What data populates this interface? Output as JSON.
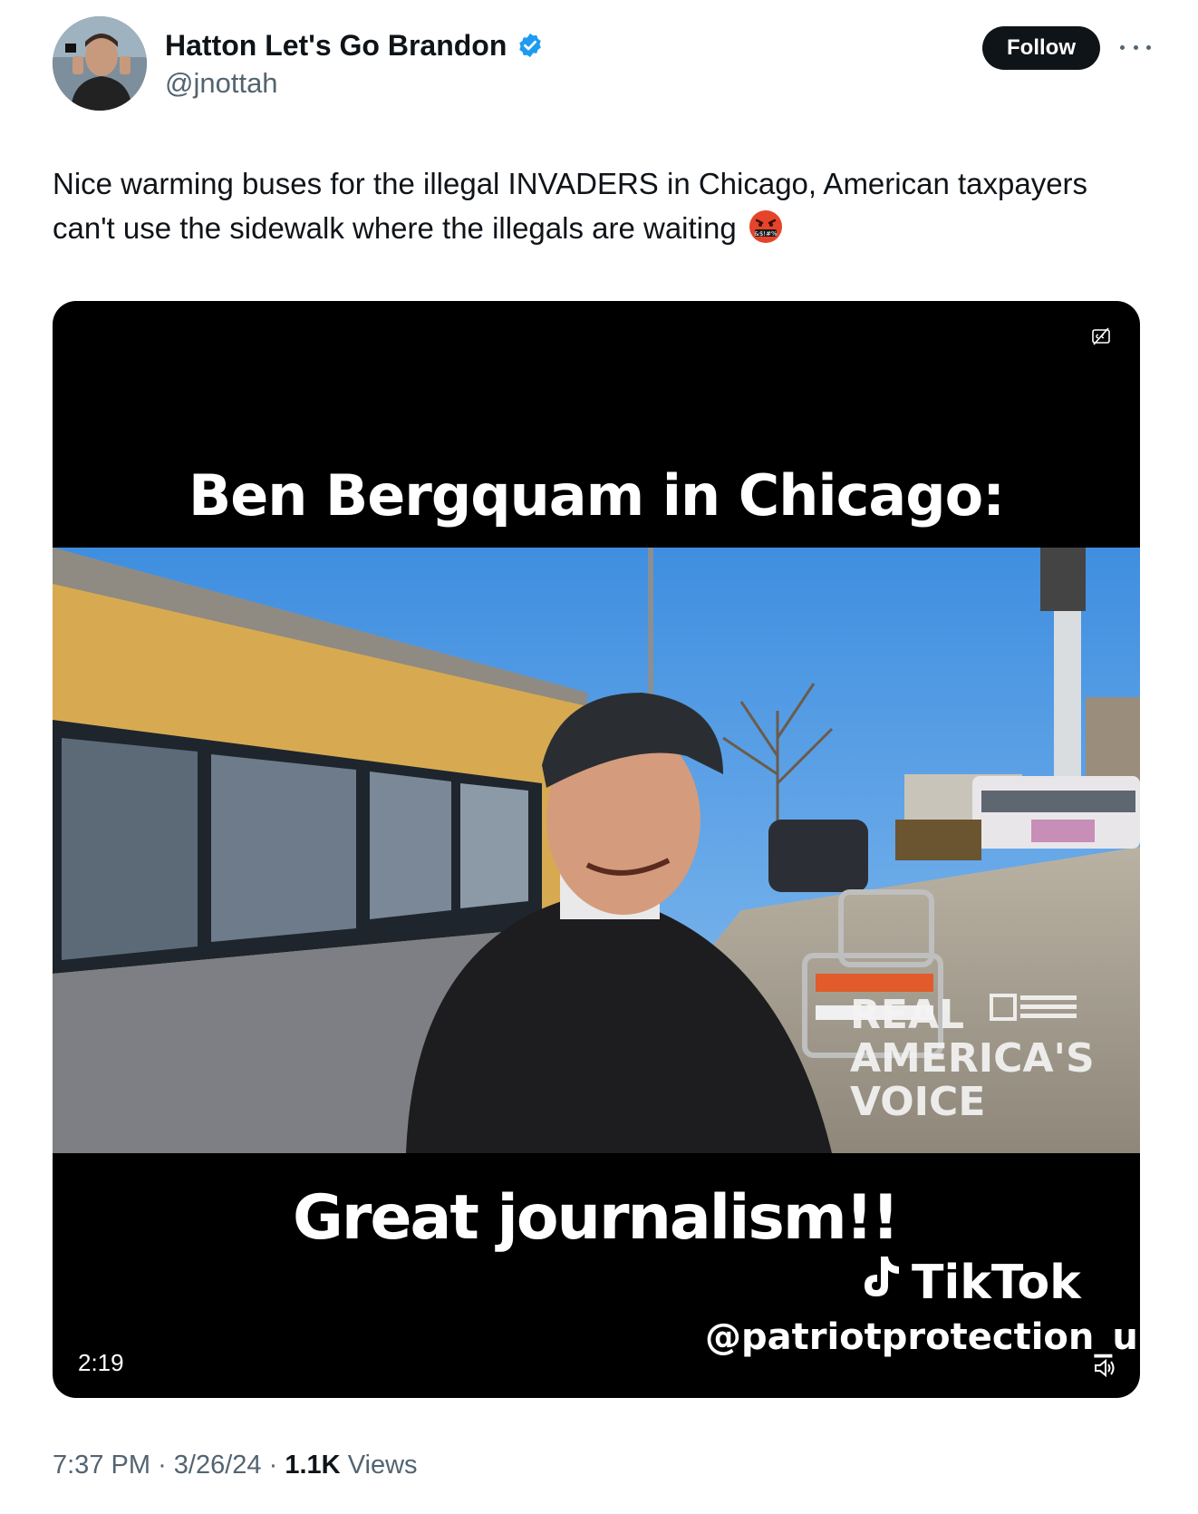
{
  "author": {
    "display_name": "Hatton Let's Go Brandon",
    "handle": "@jnottah",
    "verified": true,
    "follow_label": "Follow",
    "accent_color": "#1d9bf0"
  },
  "tweet": {
    "text": "Nice warming buses for the illegal INVADERS in Chicago, American taxpayers can't use the sidewalk where the illegals are waiting",
    "emoji": "face-with-symbols-on-mouth"
  },
  "video": {
    "caption_top": "Ben Bergquam in Chicago:",
    "caption_bottom": "Great journalism!!",
    "watermark_brand": "TikTok",
    "watermark_handle": "@patriotprotection_us",
    "overlay_logo_lines": [
      "REAL",
      "AMERICA'S",
      "VOICE"
    ],
    "duration": "2:19"
  },
  "meta": {
    "time": "7:37 PM",
    "separator": "·",
    "date": "3/26/24",
    "views_count": "1.1K",
    "views_label": "Views"
  }
}
